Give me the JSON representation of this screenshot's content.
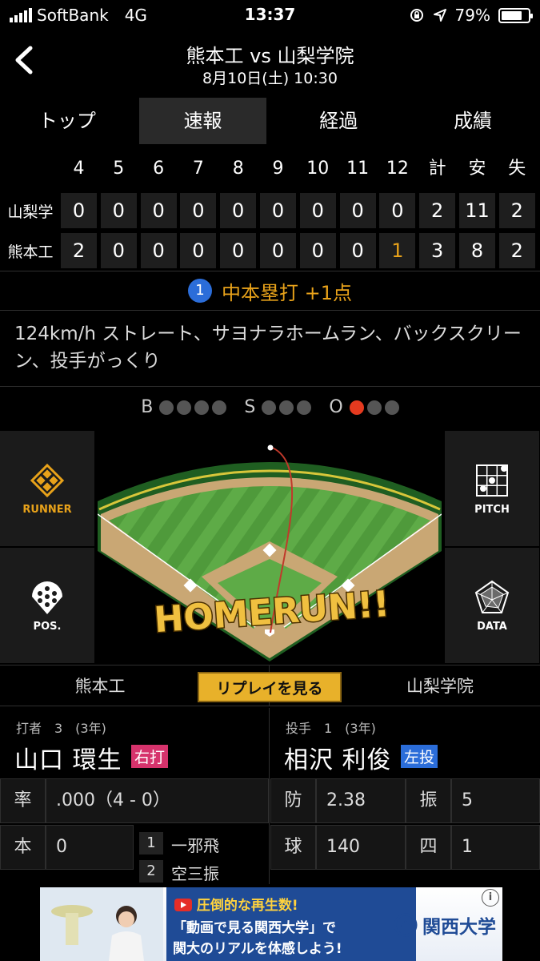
{
  "status_bar": {
    "carrier": "SoftBank",
    "network": "4G",
    "time": "13:37",
    "battery": "79%",
    "battery_level": 0.79
  },
  "header": {
    "title": "熊本工 vs 山梨学院",
    "datetime": "8月10日(土) 10:30"
  },
  "tabs": [
    {
      "label": "トップ",
      "active": false
    },
    {
      "label": "速報",
      "active": true
    },
    {
      "label": "経過",
      "active": false
    },
    {
      "label": "成績",
      "active": false
    }
  ],
  "scoreboard": {
    "headers": [
      "4",
      "5",
      "6",
      "7",
      "8",
      "9",
      "10",
      "11",
      "12",
      "計",
      "安",
      "失"
    ],
    "rows": [
      {
        "team": "山梨学",
        "cells": [
          "0",
          "0",
          "0",
          "0",
          "0",
          "0",
          "0",
          "0",
          "0",
          "2",
          "11",
          "2"
        ]
      },
      {
        "team": "熊本工",
        "cells": [
          "2",
          "0",
          "0",
          "0",
          "0",
          "0",
          "0",
          "0",
          "1",
          "3",
          "8",
          "2"
        ]
      }
    ]
  },
  "play": {
    "number": "1",
    "summary": "中本塁打 +1点",
    "description": "124km/h ストレート、サヨナラホームラン、バックスクリーン、投手がっくり"
  },
  "count": {
    "balls_label": "B",
    "strikes_label": "S",
    "outs_label": "O",
    "balls": 0,
    "strikes": 0,
    "outs": 1
  },
  "field": {
    "overlay_text": "HOMERUN!!"
  },
  "side_buttons": {
    "runner": "RUNNER",
    "pitch": "PITCH",
    "pos": "POS.",
    "data": "DATA"
  },
  "teams_bar": {
    "home": "熊本工",
    "replay": "リプレイを見る",
    "away": "山梨学院"
  },
  "batter": {
    "role": "打者　3　(3年)",
    "name": "山口 環生",
    "tag": "右打",
    "stats": {
      "avg_label": "率",
      "avg_value": ".000（4 - 0）",
      "hr_label": "本",
      "hr_value": "0"
    },
    "at_bats": [
      {
        "num": "1",
        "result": "一邪飛"
      },
      {
        "num": "2",
        "result": "空三振"
      }
    ]
  },
  "pitcher": {
    "role": "投手　1　(3年)",
    "name": "相沢 利俊",
    "tag": "左投",
    "stats": {
      "era_label": "防",
      "era_value": "2.38",
      "so_label": "振",
      "so_value": "5",
      "pitches_label": "球",
      "pitches_value": "140",
      "bb_label": "四",
      "bb_value": "1"
    }
  },
  "ad": {
    "line1": "圧倒的な再生数!",
    "line2": "「動画で見る関西大学」で",
    "line3": "関大のリアルを体感しよう!",
    "brand": "関西大学",
    "info": "i"
  },
  "colors": {
    "accent_gold": "#e8a21a",
    "play_badge": "#2b6dd9",
    "right_tag": "#d6336c",
    "left_tag": "#2b6dd9",
    "out_dot": "#e53a1f"
  }
}
